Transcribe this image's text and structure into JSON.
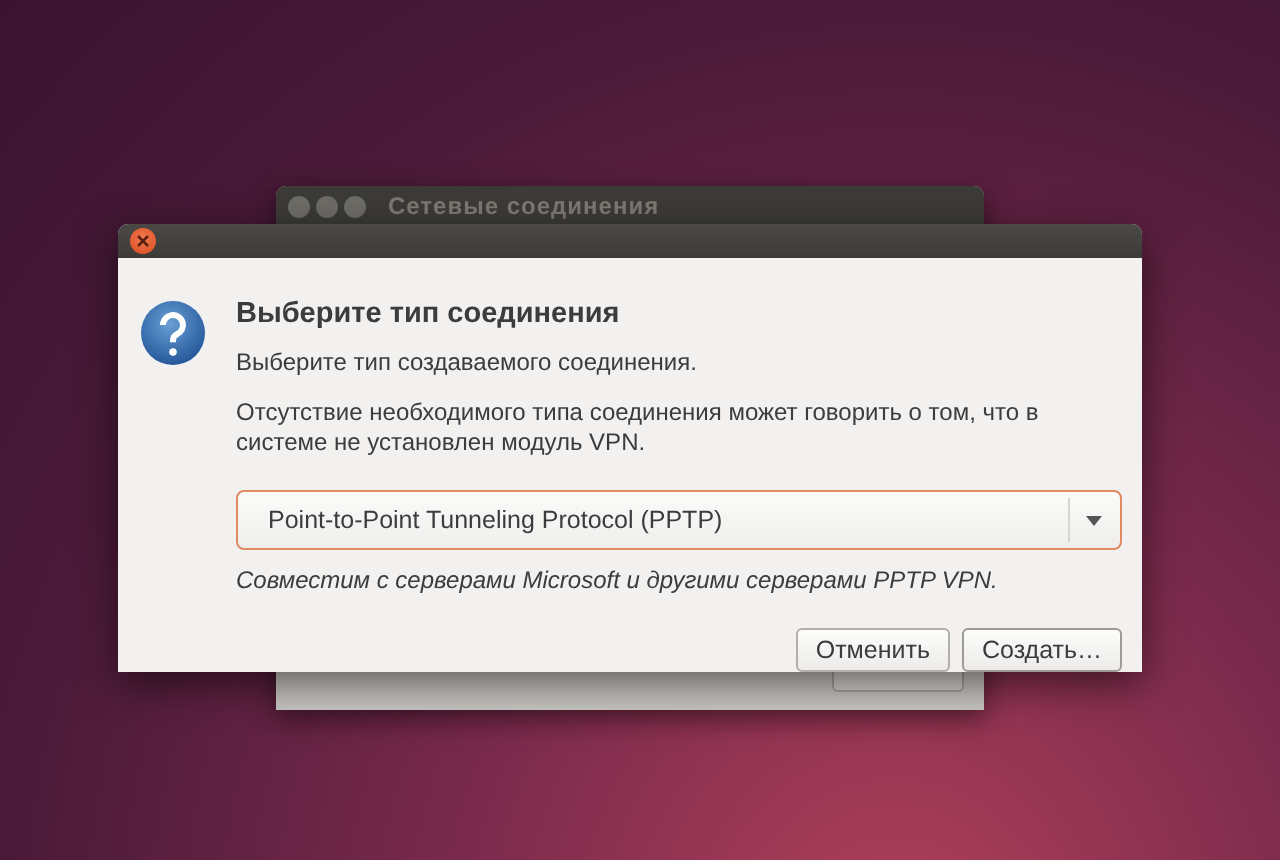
{
  "background_window": {
    "title": "Сетевые соединения"
  },
  "dialog": {
    "heading": "Выберите тип соединения",
    "subtitle": "Выберите тип создаваемого соединения.",
    "note": "Отсутствие необходимого типа соединения может говорить о том, что в системе не установлен модуль VPN.",
    "combo": {
      "value": "Point-to-Point Tunneling Protocol (PPTP)"
    },
    "hint": "Совместим с серверами Microsoft и другими серверами PPTP VPN.",
    "buttons": [
      {
        "label": "Отменить",
        "kind": "cancel"
      },
      {
        "label": "Создать…",
        "kind": "default"
      }
    ]
  }
}
